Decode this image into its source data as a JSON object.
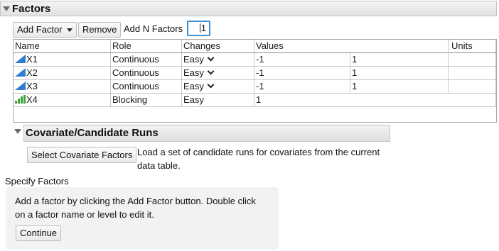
{
  "factors_outline": {
    "title": "Factors"
  },
  "toolbar": {
    "add_factor_label": "Add Factor",
    "remove_label": "Remove",
    "add_n_factors_label": "Add N Factors",
    "n_factors_value": "1"
  },
  "table": {
    "headers": {
      "name": "Name",
      "role": "Role",
      "changes": "Changes",
      "values": "Values",
      "units": "Units"
    },
    "rows": [
      {
        "name": "X1",
        "role": "Continuous",
        "changes": "Easy",
        "value1": "-1",
        "value2": "1",
        "units": "",
        "icon": "continuous-icon"
      },
      {
        "name": "X2",
        "role": "Continuous",
        "changes": "Easy",
        "value1": "-1",
        "value2": "1",
        "units": "",
        "icon": "continuous-icon"
      },
      {
        "name": "X3",
        "role": "Continuous",
        "changes": "Easy",
        "value1": "-1",
        "value2": "1",
        "units": "",
        "icon": "continuous-icon"
      },
      {
        "name": "X4",
        "role": "Blocking",
        "changes": "Easy",
        "value1": "1",
        "value2": "",
        "units": "",
        "icon": "blocking-icon"
      }
    ]
  },
  "covariate": {
    "title": "Covariate/Candidate Runs",
    "button_label": "Select Covariate Factors",
    "description_line1": "Load a set of candidate runs for covariates from the current",
    "description_line2": "data table."
  },
  "specify": {
    "title": "Specify Factors",
    "line1": "Add a factor by clicking the Add Factor button. Double click",
    "line2": "on a factor name or level to edit it.",
    "continue_label": "Continue"
  },
  "colors": {
    "accent": "#3d8fd6",
    "continuous_icon": "#2f7fd1",
    "blocking_icon": "#3ea33e"
  }
}
